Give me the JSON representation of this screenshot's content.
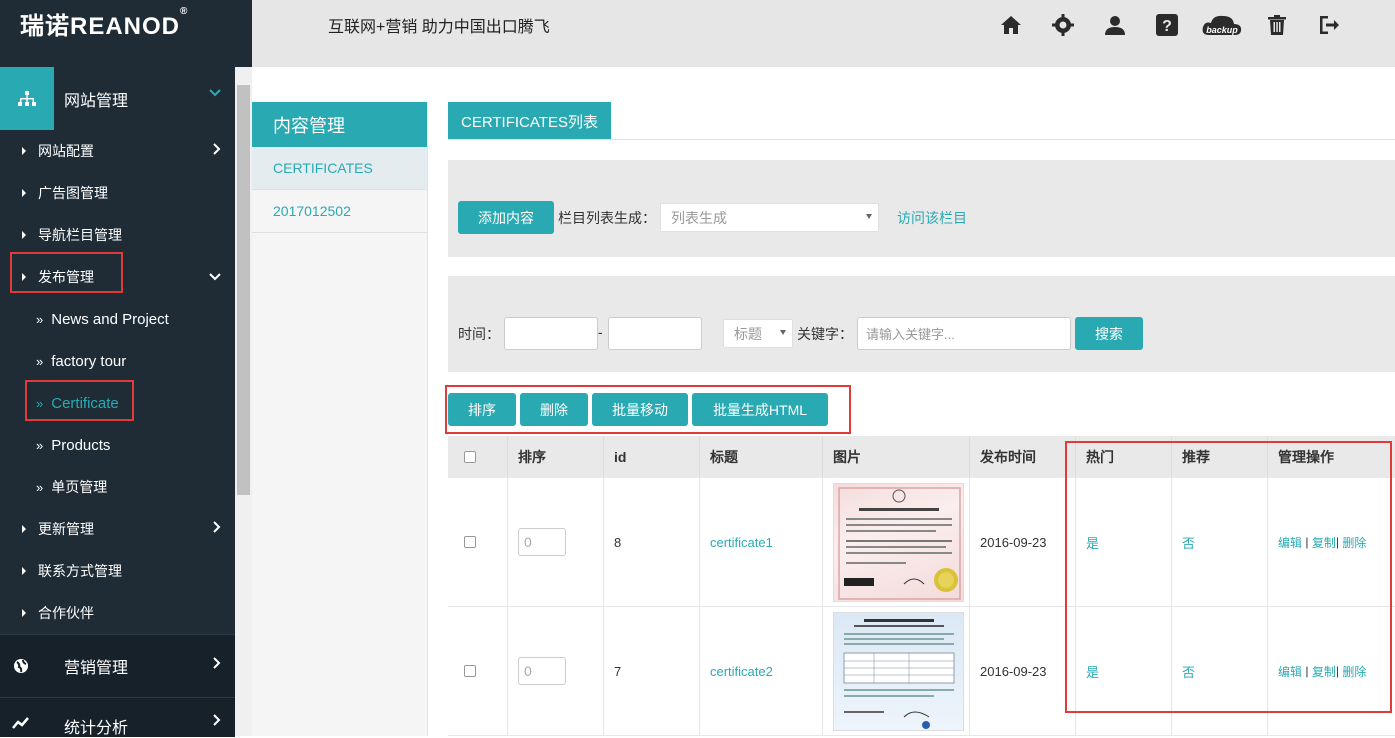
{
  "brand": {
    "logo_cn": "瑞诺",
    "logo_en": "REANOD",
    "reg": "®"
  },
  "header": {
    "slogan": "互联网+营销  助力中国出口腾飞",
    "icons": [
      "home-icon",
      "gear-icon",
      "user-icon",
      "help-icon",
      "backup-icon",
      "trash-icon",
      "logout-icon"
    ],
    "backup_label": "backup"
  },
  "sidebar": {
    "head_title": "网站管理",
    "items": [
      {
        "label": "网站配置",
        "chev": "right"
      },
      {
        "label": "广告图管理"
      },
      {
        "label": "导航栏目管理"
      },
      {
        "label": "发布管理",
        "chev": "down"
      }
    ],
    "subitems": [
      "News and Project",
      "factory tour",
      "Certificate",
      "Products",
      "单页管理"
    ],
    "items2": [
      {
        "label": "更新管理",
        "chev": "right"
      },
      {
        "label": "联系方式管理"
      },
      {
        "label": "合作伙伴"
      }
    ],
    "groups": [
      {
        "label": "营销管理"
      },
      {
        "label": "统计分析"
      }
    ],
    "bullet": "»"
  },
  "content_menu": {
    "title": "内容管理",
    "items": [
      "CERTIFICATES",
      "2017012502"
    ]
  },
  "main": {
    "tab": "CERTIFICATES列表",
    "add_button": "添加内容",
    "list_gen_label": "栏目列表生成：",
    "list_gen_placeholder": "列表生成",
    "visit_link": "访问该栏目",
    "time_label": "时间：",
    "dash": "-",
    "title_select": "标题",
    "keyword_label": "关键字：",
    "keyword_placeholder": "请输入关键字...",
    "search_button": "搜索",
    "actions": [
      "排序",
      "删除",
      "批量移动",
      "批量生成HTML"
    ]
  },
  "table": {
    "headers": [
      "排序",
      "id",
      "标题",
      "图片",
      "发布时间",
      "热门",
      "推荐",
      "管理操作"
    ],
    "rows": [
      {
        "order": "0",
        "id": "8",
        "title": "certificate1",
        "date": "2016-09-23",
        "hot": "是",
        "rec": "否"
      },
      {
        "order": "0",
        "id": "7",
        "title": "certificate2",
        "date": "2016-09-23",
        "hot": "是",
        "rec": "否"
      }
    ],
    "ops": {
      "edit": "编辑",
      "copy": "复制",
      "delete": "删除",
      "sep": "|"
    }
  },
  "colors": {
    "accent": "#29aab3",
    "sidebar": "#1f2c36",
    "highlight": "#e03a3a"
  }
}
